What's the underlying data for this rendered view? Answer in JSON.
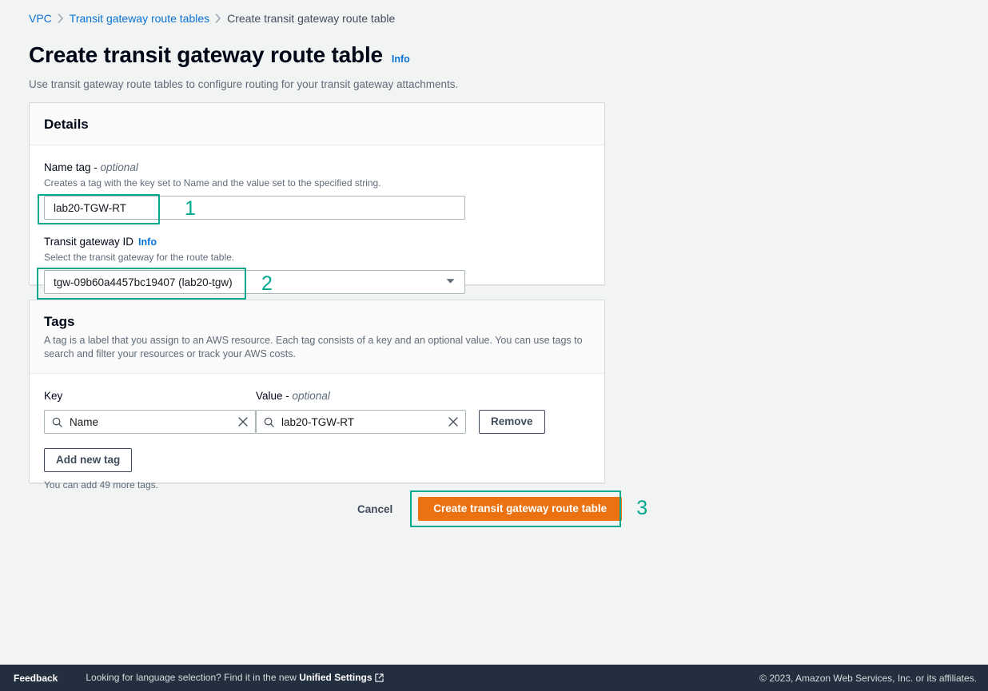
{
  "breadcrumb": {
    "items": [
      {
        "label": "VPC",
        "current": false
      },
      {
        "label": "Transit gateway route tables",
        "current": false
      },
      {
        "label": "Create transit gateway route table",
        "current": true
      }
    ]
  },
  "header": {
    "title": "Create transit gateway route table",
    "info_label": "Info",
    "description": "Use transit gateway route tables to configure routing for your transit gateway attachments."
  },
  "details": {
    "title": "Details",
    "name_tag": {
      "label": "Name tag - ",
      "label_optional": "optional",
      "description": "Creates a tag with the key set to Name and the value set to the specified string.",
      "value": "lab20-TGW-RT",
      "placeholder": ""
    },
    "transit_gateway": {
      "label": "Transit gateway ID",
      "info_label": "Info",
      "description": "Select the transit gateway for the route table.",
      "value": "tgw-09b60a4457bc19407 (lab20-tgw)",
      "chevron": "chevron-down-icon"
    }
  },
  "tags": {
    "title": "Tags",
    "description": "A tag is a label that you assign to an AWS resource. Each tag consists of a key and an optional value. You can use tags to search and filter your resources or track your AWS costs.",
    "key_column_label": "Key",
    "value_column_label": "Value - ",
    "value_column_optional": "optional",
    "rows": [
      {
        "key": "Name",
        "value": "lab20-TGW-RT",
        "remove_label": "Remove"
      }
    ],
    "add_label": "Add new tag",
    "note": "You can add 49 more tags."
  },
  "actions": {
    "cancel_label": "Cancel",
    "create_label": "Create transit gateway route table"
  },
  "annotations": {
    "color": "#00a88e",
    "markers": [
      {
        "number": "1",
        "target": "name-tag-input"
      },
      {
        "number": "2",
        "target": "transit-gateway-select"
      },
      {
        "number": "3",
        "target": "create-button"
      }
    ]
  },
  "footer": {
    "feedback_label": "Feedback",
    "language_prefix": "Looking for language selection? Find it in the new ",
    "language_link": "Unified Settings",
    "external_icon": "external-link-icon",
    "copyright": "© 2023, Amazon Web Services, Inc. or its affiliates."
  },
  "colors": {
    "accent_orange": "#ec7211",
    "link_blue": "#0972d3",
    "annotation_teal": "#00a88e",
    "footer_navy": "#232f3e",
    "page_bg": "#f2f3f3"
  }
}
